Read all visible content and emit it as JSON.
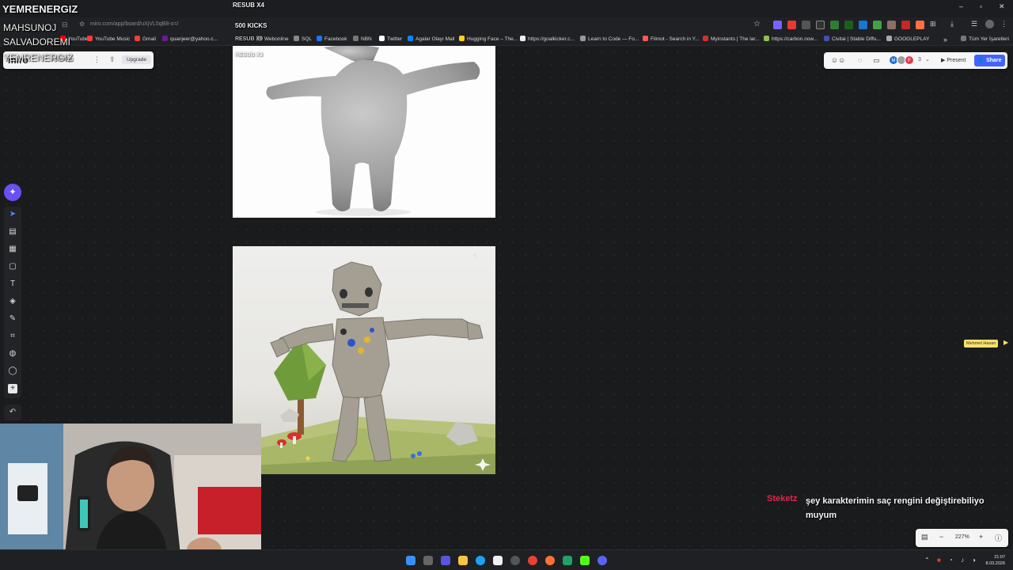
{
  "overlay": {
    "title_main": "YEMRENERGIZ",
    "title_top_right": "RESUB X4",
    "line2_left": "MAHSUNOJ",
    "line2_right": "500 KICKS",
    "line3_left": "SALVADOREMI",
    "line3_right": "RESUB X9",
    "line4_left": "YEMRENERGIZ",
    "line4_right": "RESUB X3"
  },
  "browser": {
    "address_url": "miro.com/app/board/uXjVL5qB8-o=/",
    "bookmarks": [
      {
        "label": "YouTube",
        "color": "#ff0000"
      },
      {
        "label": "YouTube Music",
        "color": "#ff3b3b"
      },
      {
        "label": "Gmail",
        "color": "#ea4335"
      },
      {
        "label": "quanjeer@yahoo.c...",
        "color": "#6a1b9a"
      },
      {
        "label": "Webonline",
        "color": "#555"
      },
      {
        "label": "SQL",
        "color": "#888"
      },
      {
        "label": "Facebook",
        "color": "#1877f2"
      },
      {
        "label": "NBN",
        "color": "#777"
      },
      {
        "label": "Twitter",
        "color": "#ffffff"
      },
      {
        "label": "Agalar Olayı Mail",
        "color": "#0a84ff"
      },
      {
        "label": "Hugging Face – The...",
        "color": "#ffd21e"
      },
      {
        "label": "https://goalkicker.c...",
        "color": "#eee"
      },
      {
        "label": "Learn to Code — Fo...",
        "color": "#999"
      },
      {
        "label": "Filmot - Search in Y...",
        "color": "#ff5a5a"
      },
      {
        "label": "Myinstants | The lar...",
        "color": "#d32f2f"
      },
      {
        "label": "https://carbon.now...",
        "color": "#8bc34a"
      },
      {
        "label": "Civitai | Stable Diffu...",
        "color": "#3f51b5"
      },
      {
        "label": "GOOGLEPLAY",
        "color": "#aaa"
      }
    ],
    "bookmarks_overflow": "»",
    "all_bookmarks": "Tüm Yer İşaretleri"
  },
  "miro": {
    "logo": "miro",
    "board_name": "Oyun Fikri",
    "upgrade_label": "Upgrade",
    "present_label": "Present",
    "share_label": "Share",
    "collaborator_count": "3",
    "avatars": [
      {
        "initial": "M",
        "color": "#1e6fd9"
      },
      {
        "initial": "",
        "color": "#9e9e9e"
      },
      {
        "initial": "F",
        "color": "#e53950"
      }
    ],
    "zoom_level": "227%",
    "cursor_user": "Mehmet Hasan"
  },
  "chat": {
    "username": "Steketz",
    "message": "şey karakterimin saç rengini değiştirebiliyo muyum"
  },
  "taskbar": {
    "time": "21:07",
    "date": "8.03.2026"
  }
}
